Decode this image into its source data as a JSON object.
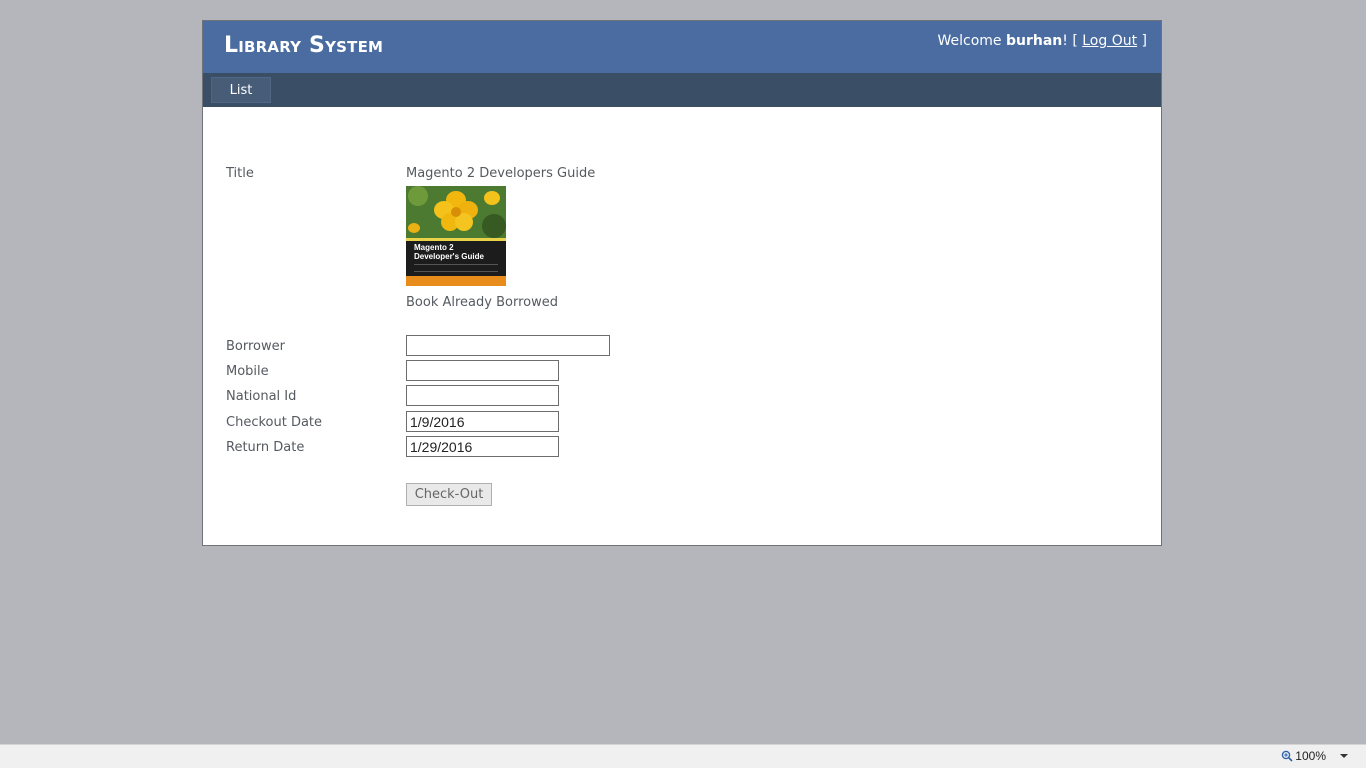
{
  "header": {
    "app_title": "Library System",
    "welcome_prefix": "Welcome ",
    "username": "burhan",
    "welcome_suffix": "! [ ",
    "logout_label": "Log Out",
    "close_bracket": " ]"
  },
  "menu": {
    "items": [
      {
        "label": "List"
      }
    ]
  },
  "details": {
    "title_label": "Title",
    "title_value": "Magento 2 Developers Guide",
    "cover": {
      "line1": "Magento 2",
      "line2": "Developer's Guide"
    },
    "status": "Book Already Borrowed"
  },
  "form": {
    "borrower": {
      "label": "Borrower",
      "value": ""
    },
    "mobile": {
      "label": "Mobile",
      "value": ""
    },
    "national_id": {
      "label": "National Id",
      "value": ""
    },
    "checkout_date": {
      "label": "Checkout Date",
      "value": "1/9/2016"
    },
    "return_date": {
      "label": "Return Date",
      "value": "1/29/2016"
    },
    "submit_label": "Check-Out"
  },
  "statusbar": {
    "zoom_level": "100%"
  },
  "colors": {
    "header_bg": "#4a6ca0",
    "menubar_bg": "#3a4f66",
    "page_bg": "#b5b6bb"
  }
}
